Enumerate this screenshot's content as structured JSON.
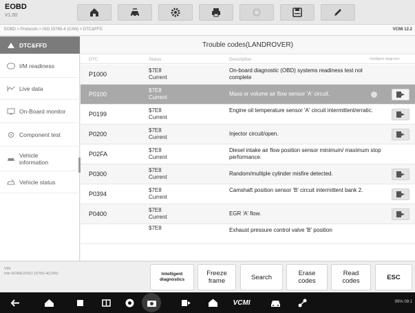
{
  "app": {
    "title": "EOBD",
    "version": "V1.00"
  },
  "toolbar": {
    "buttons": [
      {
        "name": "home-icon"
      },
      {
        "name": "vehicle-swap-icon"
      },
      {
        "name": "settings-icon"
      },
      {
        "name": "print-icon"
      },
      {
        "name": "help-icon"
      },
      {
        "name": "save-icon"
      },
      {
        "name": "edit-icon"
      }
    ]
  },
  "breadcrumb": {
    "path": "EOBD > Protocols > ISO 15765-4 (CAN) > DTC&FFD",
    "vcmi": "VCMI  12.2"
  },
  "sidebar": {
    "items": [
      {
        "label": "DTC&FFD",
        "icon": "dtc-icon",
        "active": true
      },
      {
        "label": "I/M readiness",
        "icon": "im-icon"
      },
      {
        "label": "Live data",
        "icon": "live-data-icon"
      },
      {
        "label": "On-Board monitor",
        "icon": "monitor-icon"
      },
      {
        "label": "Component test",
        "icon": "component-icon"
      },
      {
        "label": "Vehicle\ninformation",
        "icon": "car-info-icon"
      },
      {
        "label": "Vehicle status",
        "icon": "car-status-icon"
      }
    ]
  },
  "table": {
    "title": "Trouble codes(LANDROVER)",
    "headers": {
      "dtc": "DTC",
      "status": "Status",
      "description": "Description",
      "intelligent": "Intelligent diagnosis"
    },
    "rows": [
      {
        "code": "P1000",
        "status1": "$7E8",
        "status2": "Current",
        "desc": "On-board diagnostic (OBD) systems readiness test not complete"
      },
      {
        "code": "P0100",
        "status1": "$7E8",
        "status2": "Current",
        "desc": "Mass or volume air flow sensor 'A' circuit."
      },
      {
        "code": "P0199",
        "status1": "$7E8",
        "status2": "Current",
        "desc": "Engine oil temperature sensor 'A' circuit intermittent/erratic."
      },
      {
        "code": "P0200",
        "status1": "$7E8",
        "status2": "Current",
        "desc": "Injector circuit/open."
      },
      {
        "code": "P02FA",
        "status1": "$7E8",
        "status2": "Current",
        "desc": "Diesel intake air flow position sensor minimum/ maximum stop performance."
      },
      {
        "code": "P0300",
        "status1": "$7E8",
        "status2": "Current",
        "desc": "Random/multiple cylinder misfire detected."
      },
      {
        "code": "P0394",
        "status1": "$7E8",
        "status2": "Current",
        "desc": "Camshaft position sensor 'B' circuit intermittent bank 2."
      },
      {
        "code": "P0400",
        "status1": "$7E8",
        "status2": "Current",
        "desc": "EGR 'A' flow."
      },
      {
        "code": "",
        "status1": "$7E8",
        "status2": "",
        "desc": "Exhaust pressure control valve 'B' position"
      }
    ]
  },
  "vin": {
    "label": "VIN",
    "value": "Info KOREO/ISO 15765-4(CAN)"
  },
  "actions": {
    "intelligent": "Intelligent\ndiagnostics",
    "freeze": "Freeze\nframe",
    "search": "Search",
    "erase": "Erase\ncodes",
    "read": "Read\ncodes",
    "esc": "ESC"
  },
  "navbar": {
    "status": "99% 09:1"
  }
}
